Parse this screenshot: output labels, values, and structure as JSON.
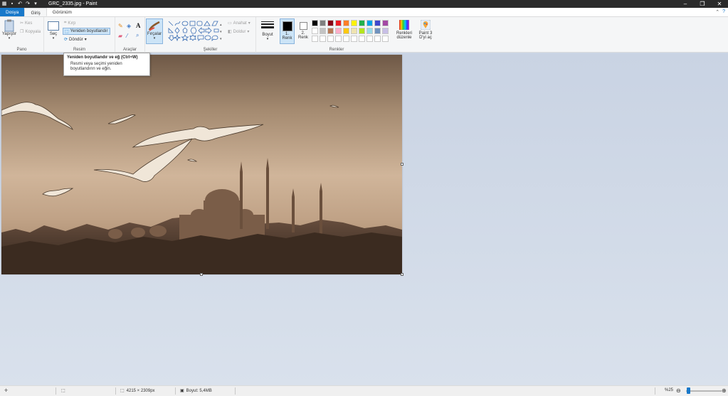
{
  "window": {
    "title": "GRC_2335.jpg - Paint",
    "minimize": "–",
    "maximize": "❐",
    "close": "✕"
  },
  "tabs": [
    {
      "label": "Dosya"
    },
    {
      "label": "Giriş"
    },
    {
      "label": "Görünüm"
    }
  ],
  "ribbon": {
    "clipboard": {
      "group_label": "Pano",
      "paste": "Yapıştır",
      "cut": "Kes",
      "copy": "Kopyala"
    },
    "image": {
      "group_label": "Resim",
      "select": "Seç",
      "crop": "Kırp",
      "resize": "Yeniden boyutlandır",
      "rotate": "Döndür"
    },
    "tools": {
      "group_label": "Araçlar",
      "brushes": "Fırçalar"
    },
    "shapes": {
      "group_label": "Şekiller",
      "outline": "Anahat",
      "fill": "Doldur"
    },
    "size": {
      "label": "Boyut"
    },
    "colors": {
      "group_label": "Renkler",
      "color1": "1.\nRenk",
      "color1_a": "1.",
      "color1_b": "Renk",
      "color2_a": "2.",
      "color2_b": "Renk",
      "edit_a": "Renkleri",
      "edit_b": "düzenle",
      "paint3d_a": "Paint 3",
      "paint3d_b": "D'yi aç",
      "color1_value": "#000000",
      "color2_value": "#ffffff",
      "palette_row1": [
        "#000000",
        "#7f7f7f",
        "#880015",
        "#ed1c24",
        "#ff7f27",
        "#fff200",
        "#22b14c",
        "#00a2e8",
        "#3f48cc",
        "#a349a4"
      ],
      "palette_row2": [
        "#ffffff",
        "#c3c3c3",
        "#b97a57",
        "#ffaec9",
        "#ffc90e",
        "#efe4b0",
        "#b5e61d",
        "#99d9ea",
        "#7092be",
        "#c8bfe7"
      ],
      "palette_row3": [
        "#ffffff",
        "#ffffff",
        "#ffffff",
        "#ffffff",
        "#ffffff",
        "#ffffff",
        "#ffffff",
        "#ffffff",
        "#ffffff",
        "#ffffff"
      ]
    }
  },
  "tooltip": {
    "title": "Yeniden boyutlandır ve eğ (Ctrl+W)",
    "line1": "Resmi veya seçimi yeniden",
    "line2": "boyutlandırın ve eğin."
  },
  "status": {
    "dimensions": "4215 × 2309px",
    "filesize": "Boyut: 5,4MB",
    "zoom": "%25"
  }
}
